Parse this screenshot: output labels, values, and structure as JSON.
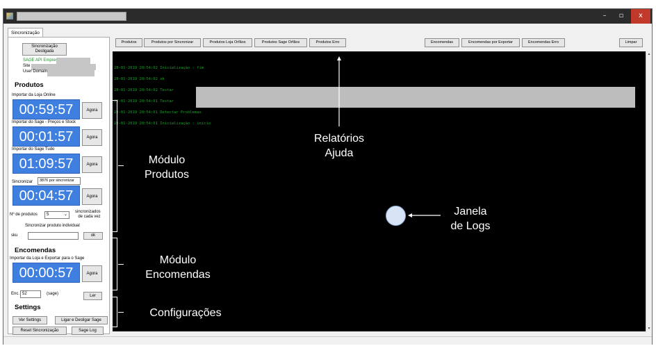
{
  "window": {
    "min_glyph": "–",
    "max_glyph": "▫",
    "close_glyph": "x"
  },
  "tab": {
    "label": "Sincronização"
  },
  "left": {
    "sync_button_lines": [
      "Sincronização",
      "Desligada"
    ],
    "sage_api": "SAGE API Empresa",
    "site_label": "Site",
    "user_domain_label": "User Domain",
    "produtos_heading": "Produtos",
    "importar_loja_label": "Importar da Loja Online",
    "importar_sage_precos_label": "Importar do Sage - Preços e Stock",
    "importar_sage_tudo_label": "Importar do Sage Tudo",
    "sincronizar_label": "Sincronizar",
    "por_sincronizar": "3876 por sincronizar",
    "timers": [
      "00:59:57",
      "00:01:57",
      "01:09:57",
      "00:04:57"
    ],
    "agora_label": "Agora",
    "n_produtos_label": "Nº de produtos",
    "n_produtos_value": "5",
    "sincronizados_lines": [
      "sincronizados",
      "de cada vez"
    ],
    "sincronizar_individual_label": "Sincronizar produto individual",
    "sku_label": "sku",
    "ok_label": "ok",
    "encomendas_heading": "Encomendas",
    "importar_exportar_label": "Importar da Loja e Exportar para o Sage",
    "encomendas_timer": "00:00:57",
    "enc_label": "Enc.",
    "enc_value": "52",
    "sage_suffix": "(sage)",
    "ler_label": "Ler",
    "settings_heading": "Settings",
    "ver_settings": "Ver Settings",
    "ligar_desligar": "Ligar e Desligar Sage",
    "reset_sync": "Reset Sincronização",
    "sage_log": "Sage Log"
  },
  "toolbar": {
    "produtos": "Produtos",
    "produtos_por_sincronizar": "Produtos por Sincronizar",
    "produtos_loja_orfaos": "Produtos Loja Orfãos",
    "produtos_sage_orfaos": "Produtos Sage Orfãos",
    "produtos_erro": "Produtos Erro",
    "encomendas": "Encomendas",
    "encomendas_por_exportar": "Encomendas por Exportar",
    "encomendas_erro": "Encomendas Erro",
    "limpar": "Limpar"
  },
  "log": {
    "lines": [
      "28-01-2019 20:54:02  Inicialização : fim",
      "28-01-2019 20:54:02  ok",
      "28-01-2019 20:54:02  Testar",
      "28-01-2019 20:54:01  Testar",
      "28-01-2019 20:54:01  Detectar Problemas",
      "28-01-2019 20:54:01  Inicialização : inicio"
    ]
  },
  "annotations": {
    "relatorios": [
      "Relatórios",
      "Ajuda"
    ],
    "janela": [
      "Janela",
      "de Logs"
    ],
    "modulo_produtos": [
      "Módulo",
      "Produtos"
    ],
    "modulo_encomendas": [
      "Módulo",
      "Encomendas"
    ],
    "configuracoes": "Configurações"
  },
  "colors": {
    "timer_blue": "#3f7fe0",
    "log_green": "#1f9e2d",
    "log_background": "#000000",
    "close_red": "#c0392b"
  }
}
